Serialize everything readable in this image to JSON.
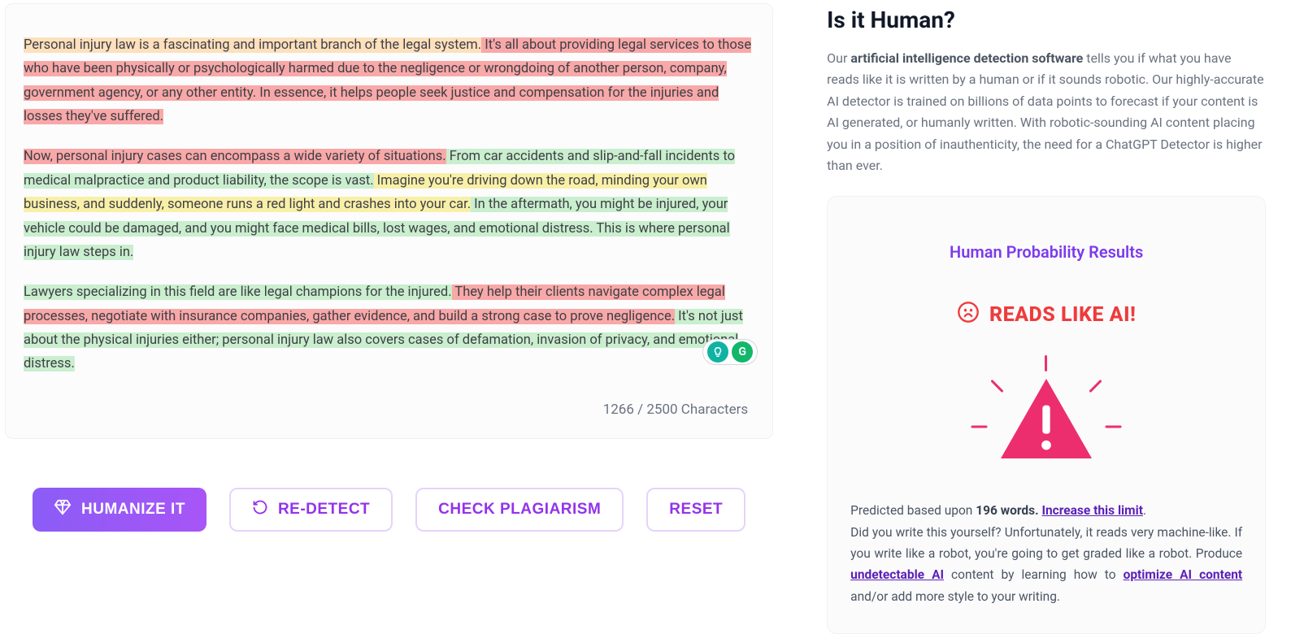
{
  "editor": {
    "p1": {
      "s1": "Personal injury law is a fascinating and important branch of the legal system.",
      "s2": " It's all about providing legal services to those who have been physically or psychologically harmed due to the negligence or wrongdoing of another person, company, government agency, or any other entity.",
      "s3": " In essence, it helps people seek justice and compensation for the injuries and losses they've suffered."
    },
    "p2": {
      "s1": "Now, personal injury cases can encompass a wide variety of situations.",
      "s2": " From car accidents and slip-and-fall incidents to medical malpractice and product liability, the scope is vast.",
      "s3": " Imagine you're driving down the road, minding your own business, and suddenly, someone runs a red light and crashes into your car.",
      "s4": " In the aftermath, you might be injured, your vehicle could be damaged, and you might face medical bills, lost wages, and emotional distress.",
      "s5": " This is where personal injury law steps in."
    },
    "p3": {
      "s1": "Lawyers specializing in this field are like legal champions for the injured.",
      "s2": " They help their clients navigate complex legal processes, negotiate with insurance companies, gather evidence, and build a strong case to prove negligence.",
      "s3": " It's not just about the physical injuries either; personal injury law also covers cases of defamation, invasion of privacy, and emotional distress."
    },
    "counter": "1266 / 2500 Characters",
    "badge_g": "G"
  },
  "actions": {
    "humanize": "HUMANIZE IT",
    "redetect": "RE-DETECT",
    "plagiarism": "CHECK PLAGIARISM",
    "reset": "RESET"
  },
  "right": {
    "heading": "Is it Human?",
    "desc_pre": "Our ",
    "desc_bold": "artificial intelligence detection software",
    "desc_post": " tells you if what you have reads like it is written by a human or if it sounds robotic. Our highly-accurate AI detector is trained on billions of data points to forecast if your content is AI generated, or humanly written. With robotic-sounding AI content placing you in a position of inauthenticity, the need for a ChatGPT Detector is higher than ever.",
    "results_title": "Human Probability Results",
    "verdict": "READS LIKE AI!",
    "pred_pre": "Predicted based upon ",
    "pred_bold": "196 words. ",
    "pred_link1": "Increase this limit",
    "pred_dot": ".",
    "pred_mid1": "Did you write this yourself? Unfortunately, it reads very machine-like. If you write like a robot, you're going to get graded like a robot. Produce ",
    "pred_link2": "undetectable AI",
    "pred_mid2": " content by learning how to ",
    "pred_link3": "optimize AI content",
    "pred_tail": " and/or add more style to your writing."
  }
}
